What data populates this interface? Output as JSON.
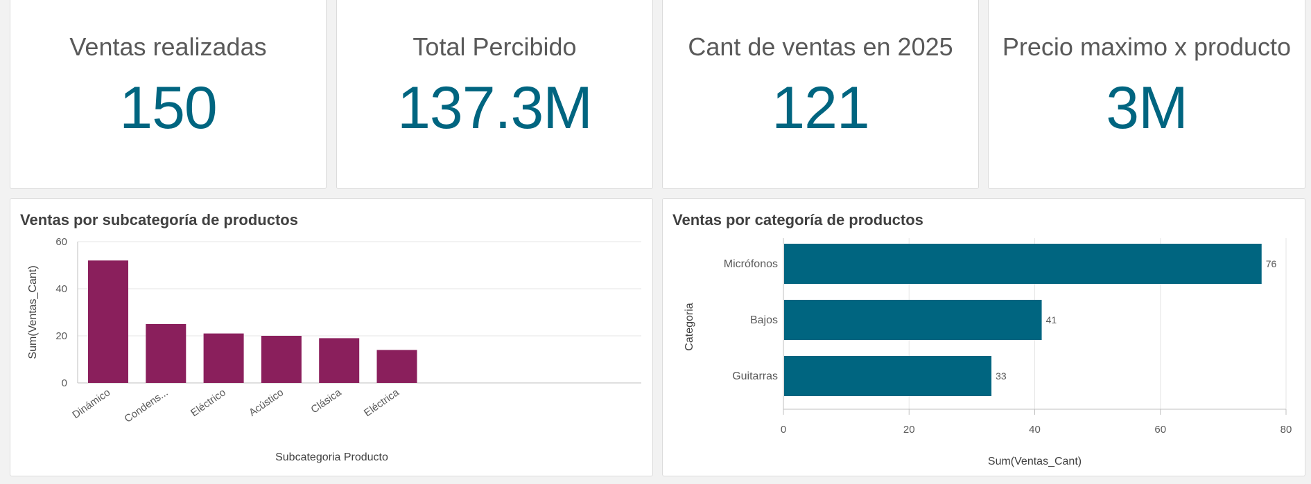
{
  "kpis": [
    {
      "title": "Ventas realizadas",
      "value": "150"
    },
    {
      "title": "Total Percibido",
      "value": "137.3M"
    },
    {
      "title": "Cant de ventas en 2025",
      "value": "121"
    },
    {
      "title": "Precio maximo x producto",
      "value": "3M"
    }
  ],
  "colors": {
    "kpi_value": "#006580",
    "bar_chart_1": "#8a1f5c",
    "bar_chart_2": "#006580"
  },
  "chart_data": [
    {
      "type": "bar",
      "orientation": "vertical",
      "title": "Ventas por subcategoría de productos",
      "xlabel": "Subcategoria Producto",
      "ylabel": "Sum(Ventas_Cant)",
      "categories": [
        "Dinámico",
        "Condens...",
        "Eléctrico",
        "Acústico",
        "Clásica",
        "Eléctrica"
      ],
      "values": [
        52,
        25,
        21,
        20,
        19,
        14
      ],
      "ylim": [
        0,
        60
      ],
      "yticks": [
        0,
        20,
        40,
        60
      ],
      "grid": true,
      "color": "#8a1f5c"
    },
    {
      "type": "bar",
      "orientation": "horizontal",
      "title": "Ventas por categoría de productos",
      "xlabel": "Sum(Ventas_Cant)",
      "ylabel": "Categoria",
      "categories": [
        "Micrófonos",
        "Bajos",
        "Guitarras"
      ],
      "values": [
        76,
        41,
        33
      ],
      "xlim": [
        0,
        80
      ],
      "xticks": [
        0,
        20,
        40,
        60,
        80
      ],
      "data_labels": true,
      "grid": true,
      "color": "#006580"
    }
  ]
}
